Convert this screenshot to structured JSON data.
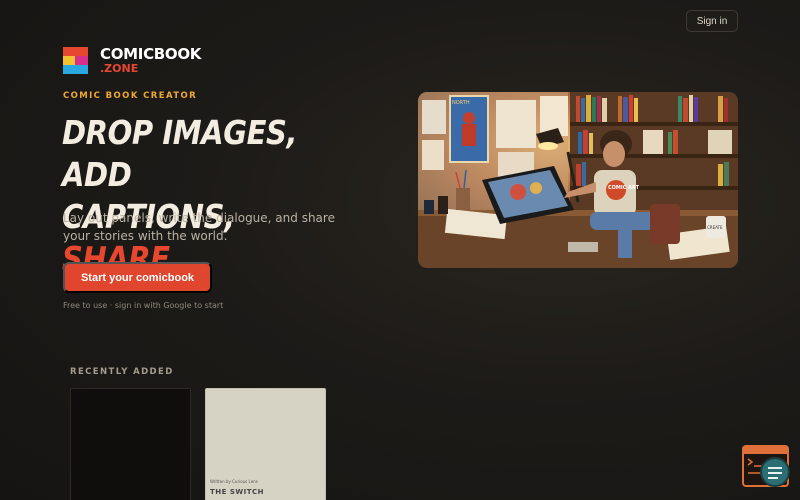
{
  "header": {
    "signin_label": "Sign in"
  },
  "brand": {
    "line1": "COMICBOOK",
    "line2": ".ZONE",
    "colors": {
      "red": "#e8472f",
      "yellow": "#f2c230",
      "blue": "#2aa8e0",
      "magenta": "#d8308a"
    }
  },
  "hero": {
    "eyebrow": "COMIC BOOK CREATOR",
    "headline_line1": "DROP IMAGES, ADD",
    "headline_line2": "CAPTIONS, ",
    "headline_accent": "SHARE.",
    "subtitle": "Lay out panels, write the dialogue, and share your stories with the world.",
    "cta_label": "Start your comicbook",
    "note": "Free to use · sign in with Google to start",
    "image_icon": "comic-artist-illustration",
    "illustration_text": {
      "poster": "NORTH",
      "shirt": "COMIC ART",
      "mug": "CREATE"
    }
  },
  "recent": {
    "label": "RECENTLY ADDED",
    "cards": [
      {
        "caption": "",
        "title": ""
      },
      {
        "caption": "Written by Curious Lens",
        "title": "THE SWITCH"
      }
    ]
  },
  "widget": {
    "icon": "terminal-chat-icon"
  },
  "theme": {
    "accent": "#e0452d",
    "eyebrow": "#f0a830",
    "background": "#1d1b18"
  }
}
